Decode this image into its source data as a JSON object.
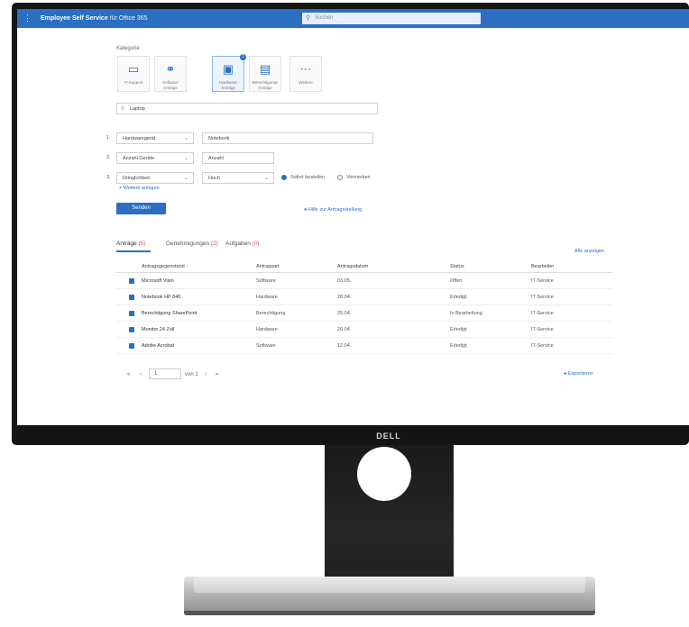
{
  "app": {
    "title": "Employee Self Service",
    "subtitle": "für Office 365"
  },
  "search": {
    "placeholder": "Suchen"
  },
  "categories": {
    "label": "Kategorie",
    "tiles": [
      {
        "label": "IT-Support",
        "icon": "chat-icon",
        "selected": false
      },
      {
        "label": "Software Anträge",
        "icon": "network-icon",
        "selected": false
      },
      {
        "label": "Hardware Anträge",
        "icon": "laptop-icon",
        "selected": true,
        "badge": "1"
      },
      {
        "label": "Berechtigungs Anträge",
        "icon": "folder-icon",
        "selected": false
      },
      {
        "label": "Weitere",
        "icon": "more-icon",
        "selected": false
      }
    ]
  },
  "form": {
    "search_value": "Laptop",
    "rows": [
      {
        "num": "1.",
        "select": "Hardwaregerät",
        "value": "Notebook"
      },
      {
        "num": "2.",
        "select": "Anzahl Geräte",
        "value": "Anzahl"
      },
      {
        "num": "3.",
        "select": "Dringlichkeit",
        "value": "Hoch",
        "radio_on": "Sofort bestellen",
        "radio_off": "Vormerken"
      }
    ],
    "add_link": "+ Weitere anlegen",
    "submit": "Senden",
    "help_link": "Hilfe zur Antragsstellung"
  },
  "tabs": [
    {
      "label": "Anträge",
      "count": "(5)"
    },
    {
      "label": "Genehmigungen",
      "count": "(2)"
    },
    {
      "label": "Aufgaben",
      "count": "(0)"
    }
  ],
  "table": {
    "action_link": "Alle anzeigen",
    "headers": [
      "Antragsgegenstand ↑",
      "Antragsart",
      "Antragsdatum",
      "Status",
      "Bearbeiter"
    ],
    "rows": [
      [
        "Microsoft Visio",
        "Software",
        "03.05.",
        "Offen",
        "IT-Service"
      ],
      [
        "Notebook HP 840",
        "Hardware",
        "28.04.",
        "Erledigt",
        "IT-Service"
      ],
      [
        "Berechtigung SharePoint",
        "Berechtigung",
        "25.04.",
        "In Bearbeitung",
        "IT-Service"
      ],
      [
        "Monitor 24 Zoll",
        "Hardware",
        "20.04.",
        "Erledigt",
        "IT-Service"
      ],
      [
        "Adobe Acrobat",
        "Software",
        "12.04.",
        "Erledigt",
        "IT-Service"
      ]
    ]
  },
  "pagination": {
    "first": "«",
    "prev": "‹",
    "page": "1",
    "of": "von 1",
    "next": "›",
    "last": "»",
    "export": "Exportieren"
  },
  "monitor": {
    "brand": "DELL"
  }
}
